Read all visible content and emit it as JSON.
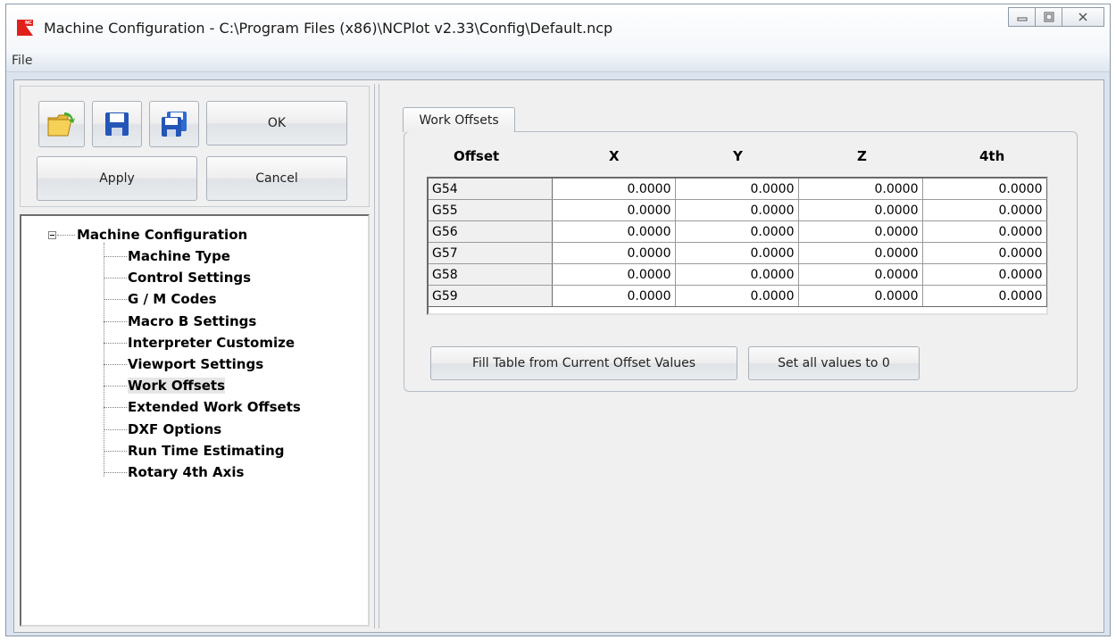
{
  "window": {
    "title": "Machine Configuration - C:\\Program Files (x86)\\NCPlot v2.33\\Config\\Default.ncp",
    "icon_label": "NC"
  },
  "menu": {
    "file_label": "File"
  },
  "toolbar": {
    "open_icon": "open-folder-icon",
    "save_icon": "save-icon",
    "save_as_icon": "save-as-icon",
    "ok_label": "OK",
    "apply_label": "Apply",
    "cancel_label": "Cancel"
  },
  "tree": {
    "root": "Machine Configuration",
    "items": [
      "Machine Type",
      "Control Settings",
      "G / M Codes",
      "Macro B Settings",
      "Interpreter Customize",
      "Viewport Settings",
      "Work Offsets",
      "Extended Work Offsets",
      "DXF Options",
      "Run Time Estimating",
      "Rotary 4th Axis"
    ],
    "selected": "Work Offsets"
  },
  "tab": {
    "label": "Work Offsets"
  },
  "offsets": {
    "headers": [
      "Offset",
      "X",
      "Y",
      "Z",
      "4th"
    ],
    "rows": [
      [
        "G54",
        "0.0000",
        "0.0000",
        "0.0000",
        "0.0000"
      ],
      [
        "G55",
        "0.0000",
        "0.0000",
        "0.0000",
        "0.0000"
      ],
      [
        "G56",
        "0.0000",
        "0.0000",
        "0.0000",
        "0.0000"
      ],
      [
        "G57",
        "0.0000",
        "0.0000",
        "0.0000",
        "0.0000"
      ],
      [
        "G58",
        "0.0000",
        "0.0000",
        "0.0000",
        "0.0000"
      ],
      [
        "G59",
        "0.0000",
        "0.0000",
        "0.0000",
        "0.0000"
      ]
    ]
  },
  "actions": {
    "fill_label": "Fill Table from Current Offset Values",
    "zero_label": "Set all values to 0"
  },
  "colors": {
    "selection": "#e6e6e6",
    "frame": "#dbe4ee",
    "icon_red": "#e0201b",
    "save_blue": "#2456b8"
  }
}
